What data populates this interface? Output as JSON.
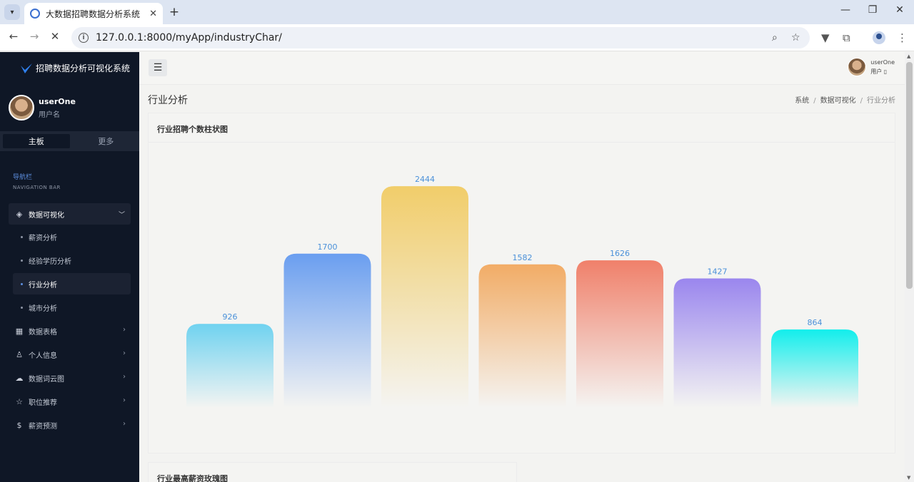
{
  "browser": {
    "tab_title": "大数据招聘数据分析系统",
    "url": "127.0.0.1:8000/myApp/industryChar/"
  },
  "sidebar": {
    "brand": "招聘数据分析可视化系统",
    "user_name": "userOne",
    "user_role": "用户名",
    "tabs": [
      "主板",
      "更多"
    ],
    "nav_head_cn": "导航栏",
    "nav_head_en": "NAVIGATION BAR",
    "group": "数据可视化",
    "subitems": [
      "薪资分析",
      "经验学历分析",
      "行业分析",
      "城市分析"
    ],
    "items": [
      {
        "label": "数据表格",
        "icon": "table-icon"
      },
      {
        "label": "个人信息",
        "icon": "user-icon"
      },
      {
        "label": "数据词云图",
        "icon": "cloud-icon"
      },
      {
        "label": "职位推荐",
        "icon": "star-icon"
      },
      {
        "label": "薪资预测",
        "icon": "dollar-icon"
      }
    ]
  },
  "header": {
    "user_name": "userOne",
    "user_role": "用户"
  },
  "page": {
    "title": "行业分析",
    "breadcrumb": [
      "系统",
      "数据可视化",
      "行业分析"
    ]
  },
  "card1": {
    "title": "行业招聘个数柱状图"
  },
  "card2": {
    "title": "行业最高薪资玫瑰图"
  },
  "chart_data": {
    "type": "bar",
    "values": [
      926,
      1700,
      2444,
      1582,
      1626,
      1427,
      864
    ],
    "colors": [
      "#6fd2f0",
      "#6a9ef0",
      "#f1cd6a",
      "#f2ac66",
      "#f0806a",
      "#9a86ee",
      "#12eeec"
    ],
    "label_color": "#4a90d9"
  }
}
